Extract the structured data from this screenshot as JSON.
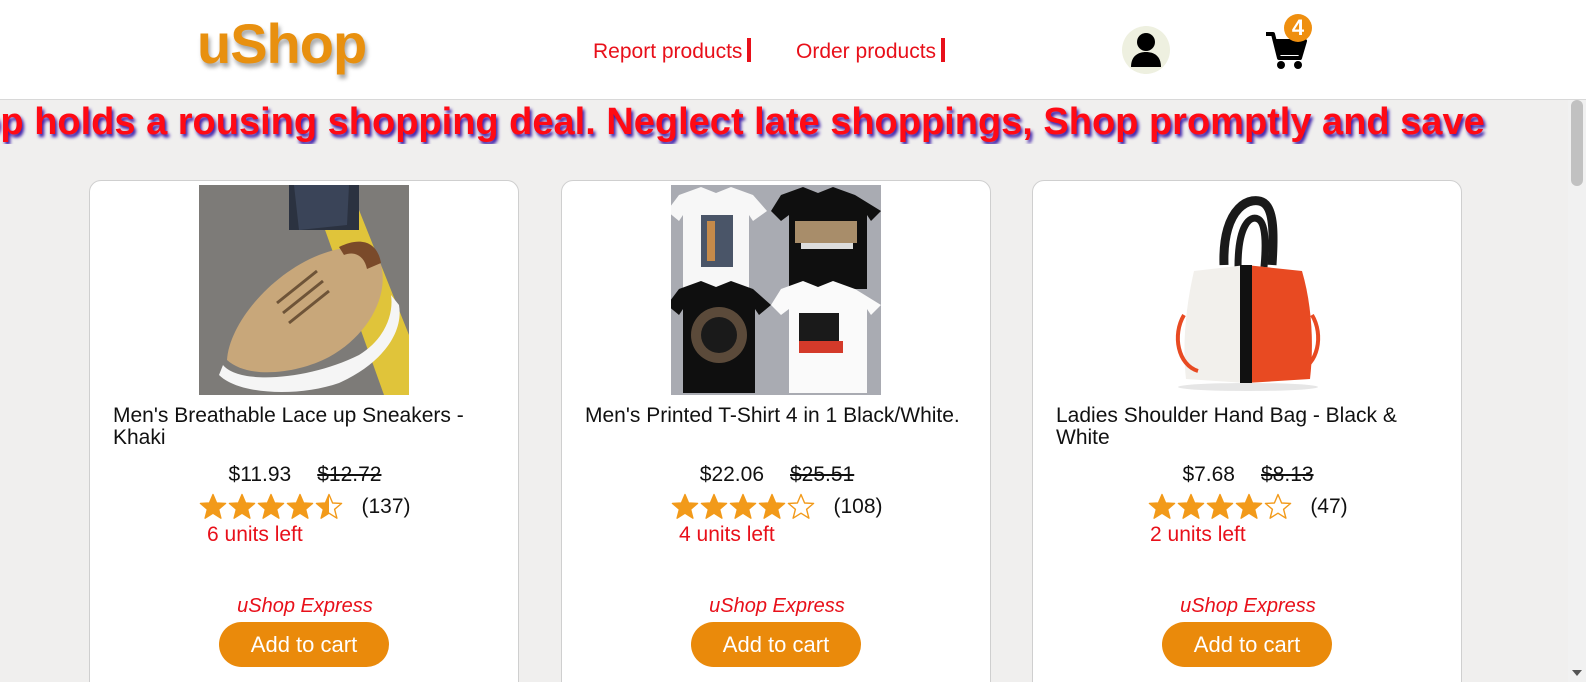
{
  "header": {
    "logo": "uShop",
    "nav": [
      {
        "label": "Report products"
      },
      {
        "label": "Order products"
      }
    ],
    "user_icon": "user-icon",
    "cart_icon": "shopping-cart-icon",
    "cart_count": "4"
  },
  "banner": {
    "text": "hop holds a rousing shopping deal. Neglect late shoppings, Shop promptly and save"
  },
  "products": [
    {
      "title": "Men's Breathable Lace up Sneakers - Khaki",
      "price": "$11.93",
      "old_price": "$12.72",
      "rating": 4.5,
      "reviews": "(137)",
      "units_left": "6 units left",
      "express": "uShop Express",
      "button": "Add to cart",
      "image": "khaki-sneaker-photo"
    },
    {
      "title": "Men's Printed T-Shirt 4 in 1 Black/White.",
      "price": "$22.06",
      "old_price": "$25.51",
      "rating": 4,
      "reviews": "(108)",
      "units_left": "4 units left",
      "express": "uShop Express",
      "button": "Add to cart",
      "image": "printed-tshirts-photo"
    },
    {
      "title": "Ladies Shoulder Hand Bag - Black & White",
      "price": "$7.68",
      "old_price": "$8.13",
      "rating": 4,
      "reviews": "(47)",
      "units_left": "2 units left",
      "express": "uShop Express",
      "button": "Add to cart",
      "image": "handbag-photo"
    }
  ],
  "colors": {
    "brand_orange": "#ea8a0b",
    "accent_red": "#e8101a",
    "star": "#f29a1a"
  }
}
